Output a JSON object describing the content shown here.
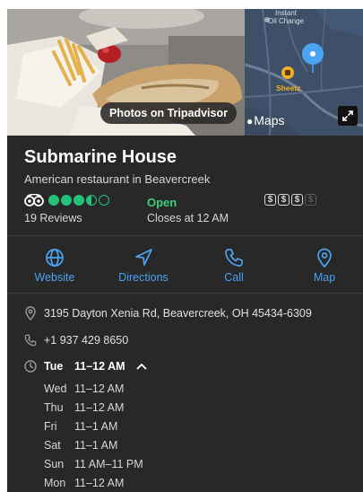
{
  "media": {
    "photos_button_label": "Photos on Tripadvisor",
    "maps_logo_text": "Maps",
    "map_labels": {
      "instant_oil_change": "Instant\nOil Change",
      "sheetz": "Sheetz"
    }
  },
  "business": {
    "name": "Submarine House",
    "category": "American restaurant in Beavercreek",
    "rating_bubbles": 3.5,
    "rating_max": 5,
    "reviews_text": "19 Reviews",
    "status": "Open",
    "closes_text": "Closes at 12 AM",
    "price_level": 3,
    "price_symbols": [
      "$",
      "$",
      "$",
      "$"
    ]
  },
  "actions": [
    {
      "label": "Website"
    },
    {
      "label": "Directions"
    },
    {
      "label": "Call"
    },
    {
      "label": "Map"
    }
  ],
  "details": {
    "address": "3195 Dayton Xenia Rd, Beavercreek, OH 45434-6309",
    "phone": "+1 937 429 8650"
  },
  "hours": {
    "today": {
      "day": "Tue",
      "time": "11–12 AM"
    },
    "rows": [
      {
        "day": "Wed",
        "time": "11–12 AM"
      },
      {
        "day": "Thu",
        "time": "11–12 AM"
      },
      {
        "day": "Fri",
        "time": "11–1 AM"
      },
      {
        "day": "Sat",
        "time": "11–1 AM"
      },
      {
        "day": "Sun",
        "time": "11 AM–11 PM"
      },
      {
        "day": "Mon",
        "time": "11–12 AM"
      }
    ]
  },
  "colors": {
    "card_background": "#282828",
    "accent_blue": "#4aa3f5",
    "tripadvisor_green": "#25c27a",
    "open_green": "#3ad07f"
  }
}
